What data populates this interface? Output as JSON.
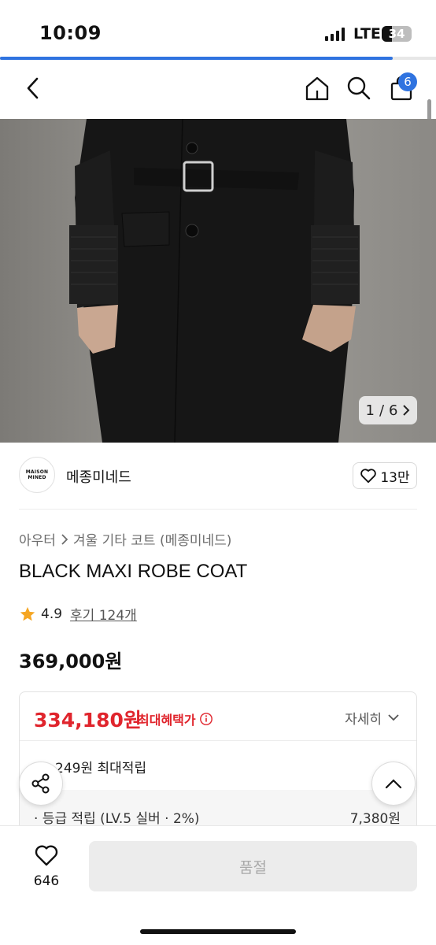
{
  "status": {
    "time": "10:09",
    "network": "LTE",
    "battery": "34",
    "battery_level": 0.34,
    "page_load_progress": 0.9
  },
  "nav": {
    "cart_count": "6"
  },
  "gallery": {
    "current": "1",
    "separator": "/",
    "total": "6"
  },
  "brand": {
    "logo_text": "MAISON MINED",
    "name": "메종미네드",
    "likes": "13만"
  },
  "product": {
    "breadcrumb": [
      "아우터",
      "겨울 기타 코트 (메종미네드)"
    ],
    "title": "BLACK MAXI ROBE COAT",
    "rating": "4.9",
    "reviews": "후기 124개",
    "price": "369,000원"
  },
  "benefit": {
    "sale_price": "334,180원",
    "sale_label": "최대혜택가",
    "detail_label": "자세히",
    "points_total": "11,249원 최대적립",
    "points_item_label": "· 등급 적립 (LV.5 실버 · 2%)",
    "points_item_value": "7,380원"
  },
  "bottom": {
    "wish_count": "646",
    "buy_label": "품절"
  },
  "colors": {
    "accent": "#2f73e0",
    "sale": "#e0252d",
    "disabled_bg": "#ececec"
  }
}
